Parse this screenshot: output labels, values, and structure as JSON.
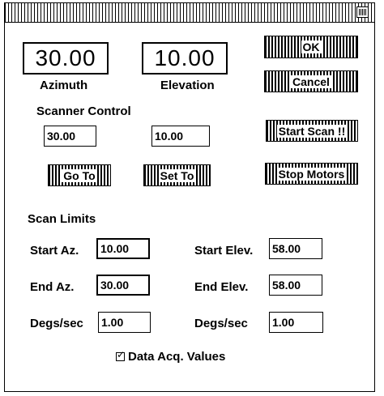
{
  "window": {
    "close_icon": "close-icon"
  },
  "display": {
    "azimuth_value": "30.00",
    "azimuth_label": "Azimuth",
    "elevation_value": "10.00",
    "elevation_label": "Elevation"
  },
  "buttons": {
    "ok": "OK",
    "cancel": "Cancel",
    "start_scan": "Start Scan !!",
    "go_to": "Go To",
    "set_to": "Set To",
    "stop_motors": "Stop Motors"
  },
  "scanner_control": {
    "title": "Scanner Control",
    "azimuth_input": "30.00",
    "elevation_input": "10.00"
  },
  "scan_limits": {
    "title": "Scan Limits",
    "start_az_label": "Start Az.",
    "start_az_value": "10.00",
    "start_elev_label": "Start Elev.",
    "start_elev_value": "58.00",
    "end_az_label": "End Az.",
    "end_az_value": "30.00",
    "end_elev_label": "End Elev.",
    "end_elev_value": "58.00",
    "az_degs_label": "Degs/sec",
    "az_degs_value": "1.00",
    "elev_degs_label": "Degs/sec",
    "elev_degs_value": "1.00"
  },
  "data_acq": {
    "label": "Data Acq. Values",
    "checked": true
  }
}
